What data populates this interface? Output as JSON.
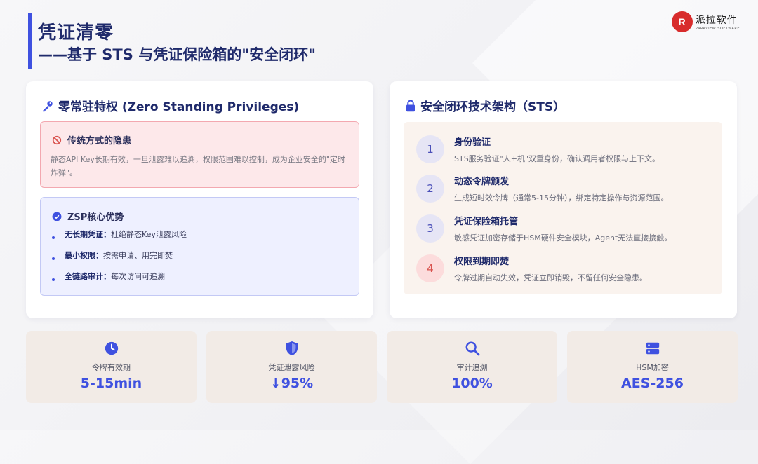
{
  "header": {
    "title": "凭证清零",
    "subtitle": "——基于 STS 与凭证保险箱的\"安全闭环\""
  },
  "logo": {
    "name": "派拉软件",
    "en": "PARAVIEW SOFTWARE",
    "mark": "R"
  },
  "left_card": {
    "title": "零常驻特权 (Zero Standing Privileges)",
    "icon": "key-icon",
    "risk": {
      "title": "传统方式的隐患",
      "text": "静态API Key长期有效，一旦泄露难以追溯，权限范围难以控制，成为企业安全的\"定时炸弹\"。"
    },
    "advantages": {
      "title": "ZSP核心优势",
      "items": [
        {
          "label": "无长期凭证：",
          "text": "杜绝静态Key泄露风险"
        },
        {
          "label": "最小权限：",
          "text": "按需申请、用完即焚"
        },
        {
          "label": "全链路审计：",
          "text": "每次访问可追溯"
        }
      ]
    }
  },
  "right_card": {
    "title": "安全闭环技术架构（STS）",
    "icon": "lock-icon",
    "steps": [
      {
        "num": "1",
        "title": "身份验证",
        "desc": "STS服务验证\"人+机\"双重身份，确认调用者权限与上下文。"
      },
      {
        "num": "2",
        "title": "动态令牌颁发",
        "desc": "生成短时效令牌（通常5-15分钟），绑定特定操作与资源范围。"
      },
      {
        "num": "3",
        "title": "凭证保险箱托管",
        "desc": "敏感凭证加密存储于HSM硬件安全模块，Agent无法直接接触。"
      },
      {
        "num": "4",
        "title": "权限到期即焚",
        "desc": "令牌过期自动失效，凭证立即销毁，不留任何安全隐患。"
      }
    ]
  },
  "stats": [
    {
      "icon": "clock-icon",
      "label": "令牌有效期",
      "value": "5-15min"
    },
    {
      "icon": "shield-icon",
      "label": "凭证泄露风险",
      "value": "↓95%"
    },
    {
      "icon": "search-icon",
      "label": "审计追溯",
      "value": "100%"
    },
    {
      "icon": "server-icon",
      "label": "HSM加密",
      "value": "AES-256"
    }
  ],
  "colors": {
    "accent": "#3f51e0",
    "danger": "#d9534f",
    "title": "#1f2a6b"
  }
}
